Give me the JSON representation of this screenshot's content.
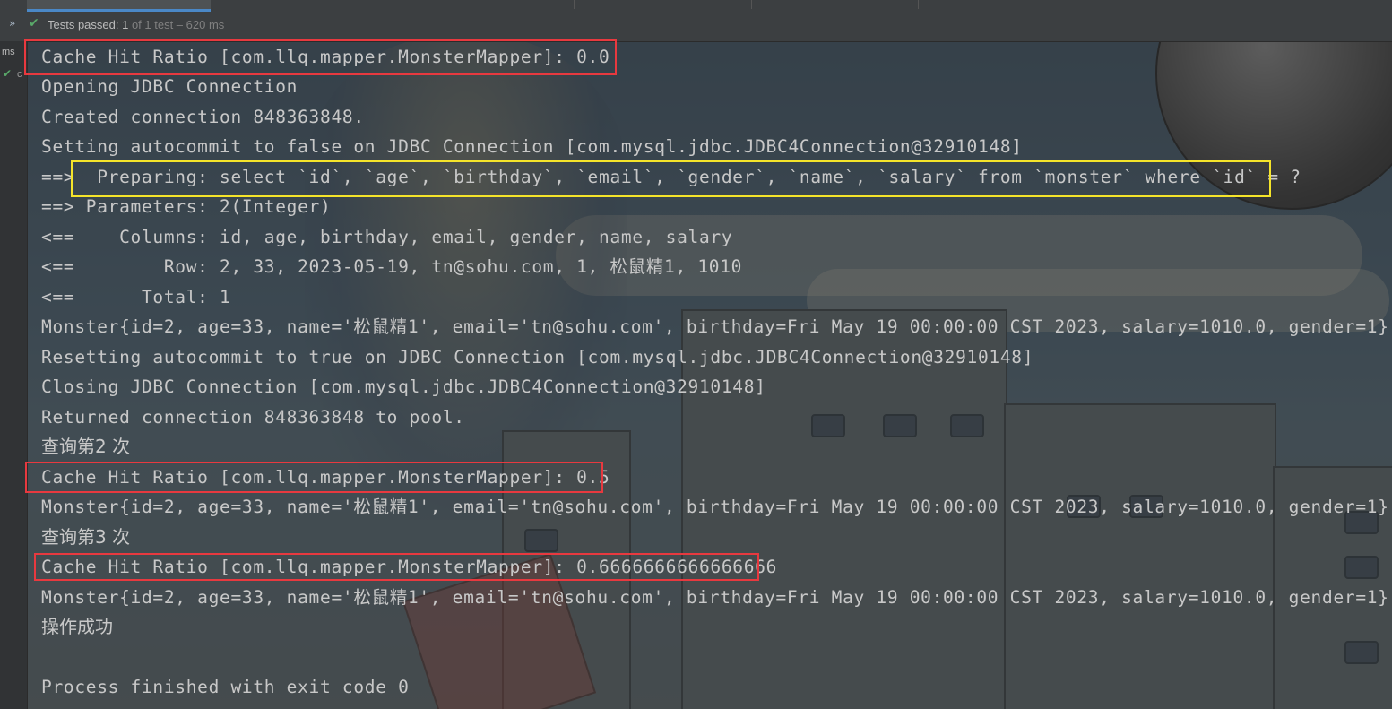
{
  "run_panel": {
    "tests_passed_label": "Tests passed: 1",
    "tests_detail": " of 1 test – 620 ms",
    "gutter_time": "ms",
    "gutter_c": "c"
  },
  "console": {
    "lines": [
      "Cache Hit Ratio [com.llq.mapper.MonsterMapper]: 0.0",
      "Opening JDBC Connection",
      "Created connection 848363848.",
      "Setting autocommit to false on JDBC Connection [com.mysql.jdbc.JDBC4Connection@32910148]",
      "==>  Preparing: select `id`, `age`, `birthday`, `email`, `gender`, `name`, `salary` from `monster` where `id` = ?",
      "==> Parameters: 2(Integer)",
      "<==    Columns: id, age, birthday, email, gender, name, salary",
      "<==        Row: 2, 33, 2023-05-19, tn@sohu.com, 1, 松鼠精1, 1010",
      "<==      Total: 1",
      "Monster{id=2, age=33, name='松鼠精1', email='tn@sohu.com', birthday=Fri May 19 00:00:00 CST 2023, salary=1010.0, gender=1}",
      "Resetting autocommit to true on JDBC Connection [com.mysql.jdbc.JDBC4Connection@32910148]",
      "Closing JDBC Connection [com.mysql.jdbc.JDBC4Connection@32910148]",
      "Returned connection 848363848 to pool.",
      "查询第2 次",
      "Cache Hit Ratio [com.llq.mapper.MonsterMapper]: 0.5",
      "Monster{id=2, age=33, name='松鼠精1', email='tn@sohu.com', birthday=Fri May 19 00:00:00 CST 2023, salary=1010.0, gender=1}",
      "查询第3 次",
      "Cache Hit Ratio [com.llq.mapper.MonsterMapper]: 0.6666666666666666",
      "Monster{id=2, age=33, name='松鼠精1', email='tn@sohu.com', birthday=Fri May 19 00:00:00 CST 2023, salary=1010.0, gender=1}",
      "操作成功",
      "",
      "Process finished with exit code 0"
    ]
  },
  "colors": {
    "console_text": "#c8c8c8",
    "highlight_red": "#e8393f",
    "highlight_yellow": "#f5e42a",
    "success_green": "#59a869"
  }
}
